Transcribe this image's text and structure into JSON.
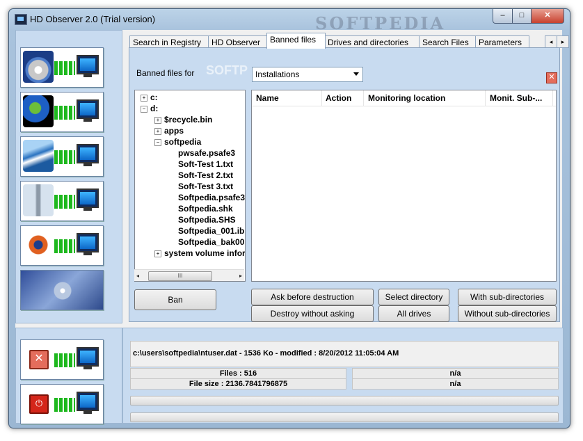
{
  "window": {
    "title": "HD Observer 2.0 (Trial version)",
    "watermark": "SOFTPEDIA"
  },
  "titlebar": {
    "min": "–",
    "max": "□",
    "close": "✕"
  },
  "tabs": [
    {
      "label": "Search in Registry"
    },
    {
      "label": "HD Observer"
    },
    {
      "label": "Banned files"
    },
    {
      "label": "Drives and directories"
    },
    {
      "label": "Search Files"
    },
    {
      "label": "Parameters"
    }
  ],
  "banned": {
    "label": "Banned files for",
    "watermark": "SOFTP",
    "combo_value": "Installations",
    "close_glyph": "✕"
  },
  "tree": [
    {
      "label": "c:",
      "exp": "+"
    },
    {
      "label": "d:",
      "exp": "−"
    },
    {
      "label": "$recycle.bin",
      "exp": "+"
    },
    {
      "label": "apps",
      "exp": "+"
    },
    {
      "label": "softpedia",
      "exp": "−"
    },
    {
      "label": "pwsafe.psafe3"
    },
    {
      "label": "Soft-Test  1.txt"
    },
    {
      "label": "Soft-Test  2.txt"
    },
    {
      "label": "Soft-Test  3.txt"
    },
    {
      "label": "Softpedia.psafe3"
    },
    {
      "label": "Softpedia.shk"
    },
    {
      "label": "Softpedia.SHS"
    },
    {
      "label": "Softpedia_001.ib"
    },
    {
      "label": "Softpedia_bak00"
    },
    {
      "label": "system volume infor",
      "exp": "+"
    }
  ],
  "hscroll": {
    "left": "◂",
    "right": "▸",
    "grip": "III"
  },
  "list_columns": [
    "Name",
    "Action",
    "Monitoring location",
    "Monit. Sub-..."
  ],
  "buttons": {
    "ban": "Ban",
    "ask": "Ask before destruction",
    "select_dir": "Select directory",
    "with_sub": "With sub-directories",
    "destroy": "Destroy without asking",
    "all_drives": "All drives",
    "without_sub": "Without sub-directories"
  },
  "status": {
    "path": "c:\\users\\softpedia\\ntuser.dat - 1536 Ko - modified : 8/20/2012 11:05:04 AM",
    "files": "Files : 516",
    "filesize": "File size : 2136.7841796875",
    "na1": "n/a",
    "na2": "n/a"
  },
  "icons": [
    "dvd-icon",
    "globe-icon",
    "wave-icon",
    "tower-icon",
    "burst-icon",
    "logo-icon",
    "stop-x-icon",
    "power-icon",
    "monitor-icon"
  ]
}
